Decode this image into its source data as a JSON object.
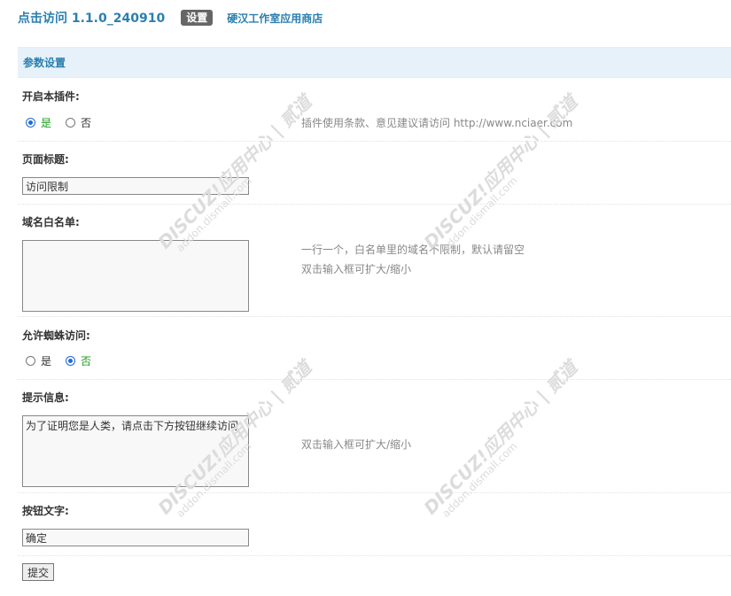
{
  "header": {
    "app_title": "点击访问 1.1.0_240910",
    "tab_label": "设置",
    "store_link": "硬汉工作室应用商店"
  },
  "section": {
    "title": "参数设置"
  },
  "fields": {
    "enable_plugin": {
      "label": "开启本插件:",
      "options": [
        "是",
        "否"
      ],
      "selected": "是",
      "hint": "插件使用条款、意见建议请访问 http://www.nciaer.com"
    },
    "page_title": {
      "label": "页面标题:",
      "value": "访问限制"
    },
    "domain_whitelist": {
      "label": "域名白名单:",
      "value": "",
      "hint_line1": "一行一个，白名单里的域名不限制，默认请留空",
      "hint_line2": "双击输入框可扩大/缩小"
    },
    "allow_spider": {
      "label": "允许蜘蛛访问:",
      "options": [
        "是",
        "否"
      ],
      "selected": "否"
    },
    "prompt_message": {
      "label": "提示信息:",
      "value": "为了证明您是人类，请点击下方按钮继续访问",
      "hint": "双击输入框可扩大/缩小"
    },
    "button_text": {
      "label": "按钮文字:",
      "value": "确定"
    }
  },
  "submit": {
    "label": "提交"
  },
  "watermark": {
    "brand": "DISCUZ!应用中心 | 贰道",
    "url": "addon.dismall.com"
  }
}
